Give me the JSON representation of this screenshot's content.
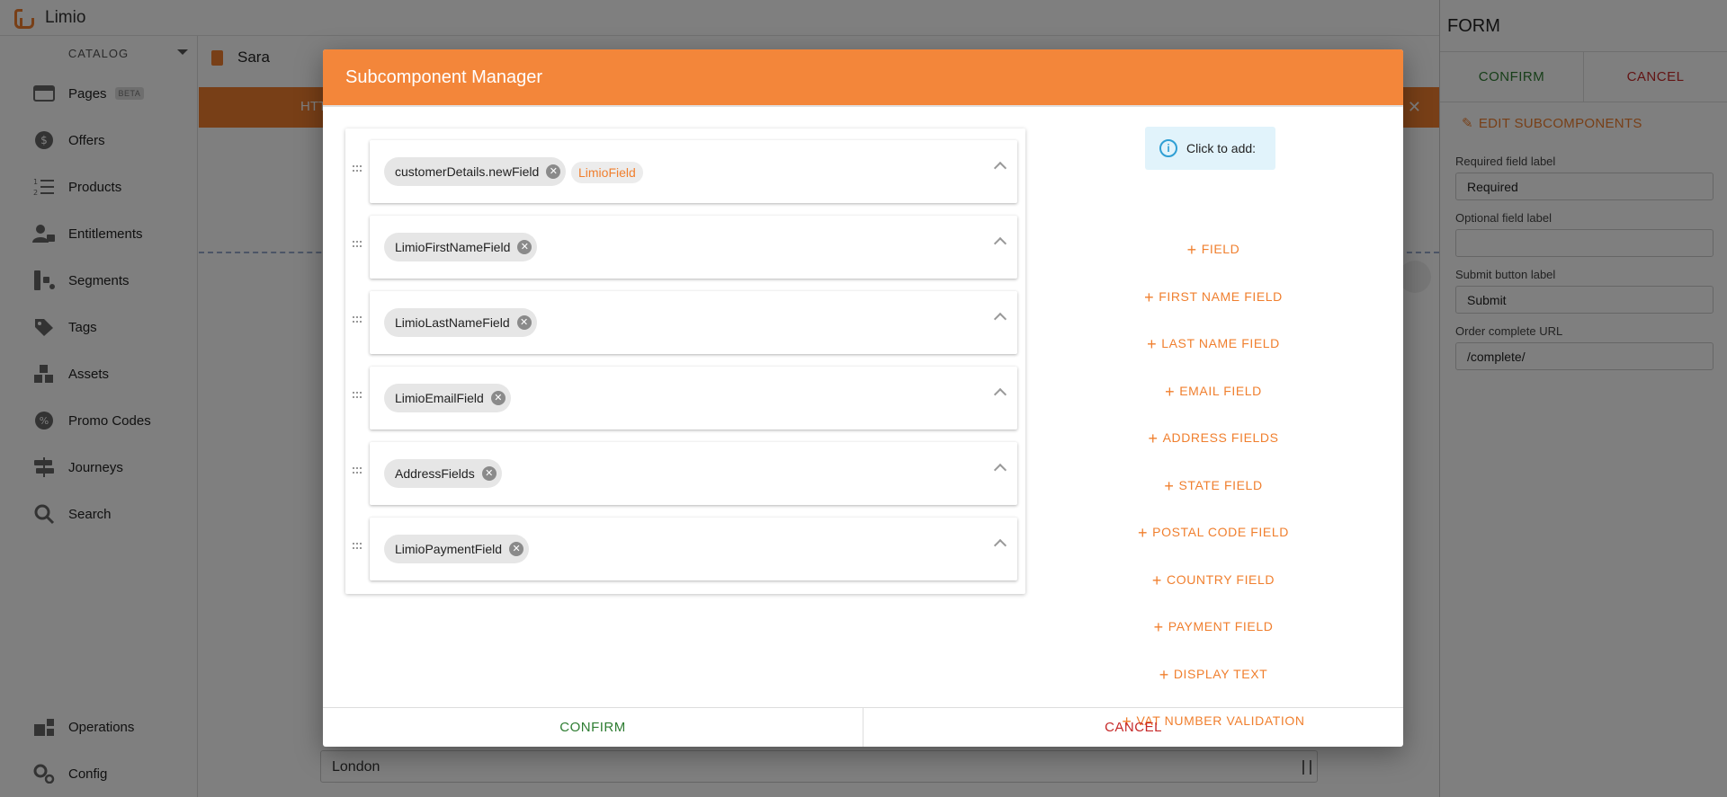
{
  "app": {
    "name": "Limio"
  },
  "sidebar": {
    "section": "CATALOG",
    "items": [
      {
        "label": "Pages",
        "icon": "pages-icon",
        "badge": "BETA"
      },
      {
        "label": "Offers",
        "icon": "offers-icon"
      },
      {
        "label": "Products",
        "icon": "products-icon"
      },
      {
        "label": "Entitlements",
        "icon": "entitlements-icon"
      },
      {
        "label": "Segments",
        "icon": "segments-icon"
      },
      {
        "label": "Tags",
        "icon": "tags-icon"
      },
      {
        "label": "Assets",
        "icon": "assets-icon"
      },
      {
        "label": "Promo Codes",
        "icon": "promo-codes-icon"
      },
      {
        "label": "Journeys",
        "icon": "journeys-icon"
      },
      {
        "label": "Search",
        "icon": "search-icon"
      }
    ],
    "bottom_items": [
      {
        "label": "Operations",
        "icon": "operations-icon"
      },
      {
        "label": "Config",
        "icon": "config-icon"
      }
    ]
  },
  "page": {
    "title": "Sara",
    "band_text": "HTT",
    "city_value": "London"
  },
  "right_panel": {
    "title": "FORM",
    "confirm": "CONFIRM",
    "cancel": "CANCEL",
    "edit_subcomponents": "EDIT SUBCOMPONENTS",
    "fields": [
      {
        "label": "Required field label",
        "value": "Required"
      },
      {
        "label": "Optional field label",
        "value": ""
      },
      {
        "label": "Submit button label",
        "value": "Submit"
      },
      {
        "label": "Order complete URL",
        "value": "/complete/"
      }
    ]
  },
  "modal": {
    "title": "Subcomponent Manager",
    "subcomponents": [
      {
        "name": "customerDetails.newField",
        "tag": "LimioField"
      },
      {
        "name": "LimioFirstNameField"
      },
      {
        "name": "LimioLastNameField"
      },
      {
        "name": "LimioEmailField"
      },
      {
        "name": "AddressFields"
      },
      {
        "name": "LimioPaymentField"
      }
    ],
    "click_to_add": "Click to add:",
    "add_options": [
      "FIELD",
      "FIRST NAME FIELD",
      "LAST NAME FIELD",
      "EMAIL FIELD",
      "ADDRESS FIELDS",
      "STATE FIELD",
      "POSTAL CODE FIELD",
      "COUNTRY FIELD",
      "PAYMENT FIELD",
      "DISPLAY TEXT",
      "VAT NUMBER VALIDATION"
    ],
    "confirm": "CONFIRM",
    "cancel": "CANCEL"
  },
  "colors": {
    "brand": "#f07f2e",
    "confirm": "#2e7d32",
    "cancel": "#c62828",
    "info": "#2f9fd4"
  }
}
